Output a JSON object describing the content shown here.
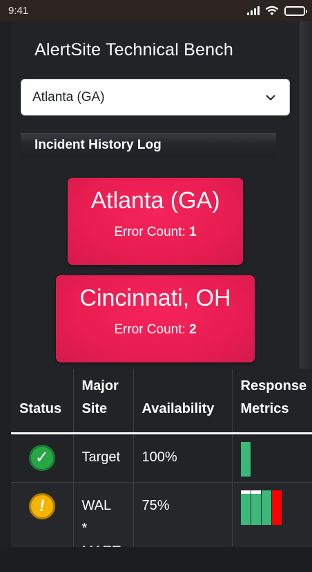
{
  "status_bar": {
    "time": "9:41"
  },
  "app": {
    "title": "AlertSite Technical Bench",
    "site_select": {
      "value": "Atlanta (GA)"
    },
    "log_header": "Incident History Log"
  },
  "incident_cards": [
    {
      "city": "Atlanta (GA)",
      "error_label": "Error Count:",
      "error_count": "1"
    },
    {
      "city": "Cincinnati, OH",
      "error_label": "Error Count:",
      "error_count": "2"
    }
  ],
  "table": {
    "headers": {
      "status": "Status",
      "major_site": "Major Site",
      "availability": "Availability",
      "response_metrics": "Response Metrics"
    },
    "rows": [
      {
        "status": "ok",
        "status_glyph": "✓",
        "status_icon": "check-circle-icon",
        "site": "Target",
        "availability": "100%",
        "metrics": [
          {
            "top": 0,
            "warn": 0,
            "color": "#3cb878"
          }
        ]
      },
      {
        "status": "warning",
        "status_glyph": "!",
        "status_icon": "exclamation-circle-icon",
        "site": "WAL * MART",
        "availability": "75%",
        "metrics": [
          {
            "top": 0.1,
            "warn": 0,
            "color": "#3cb878"
          },
          {
            "top": 0.1,
            "warn": 0,
            "color": "#3cb878"
          },
          {
            "top": 0,
            "warn": 0,
            "color": "#3cb878"
          },
          {
            "top": 0,
            "warn": 1,
            "color": "#3cb878"
          }
        ]
      }
    ]
  },
  "colors": {
    "card": "#e81d52",
    "ok": "#28a745",
    "warning": "#f5b400",
    "metric_ok": "#3cb878",
    "metric_error": "#ff0000"
  }
}
